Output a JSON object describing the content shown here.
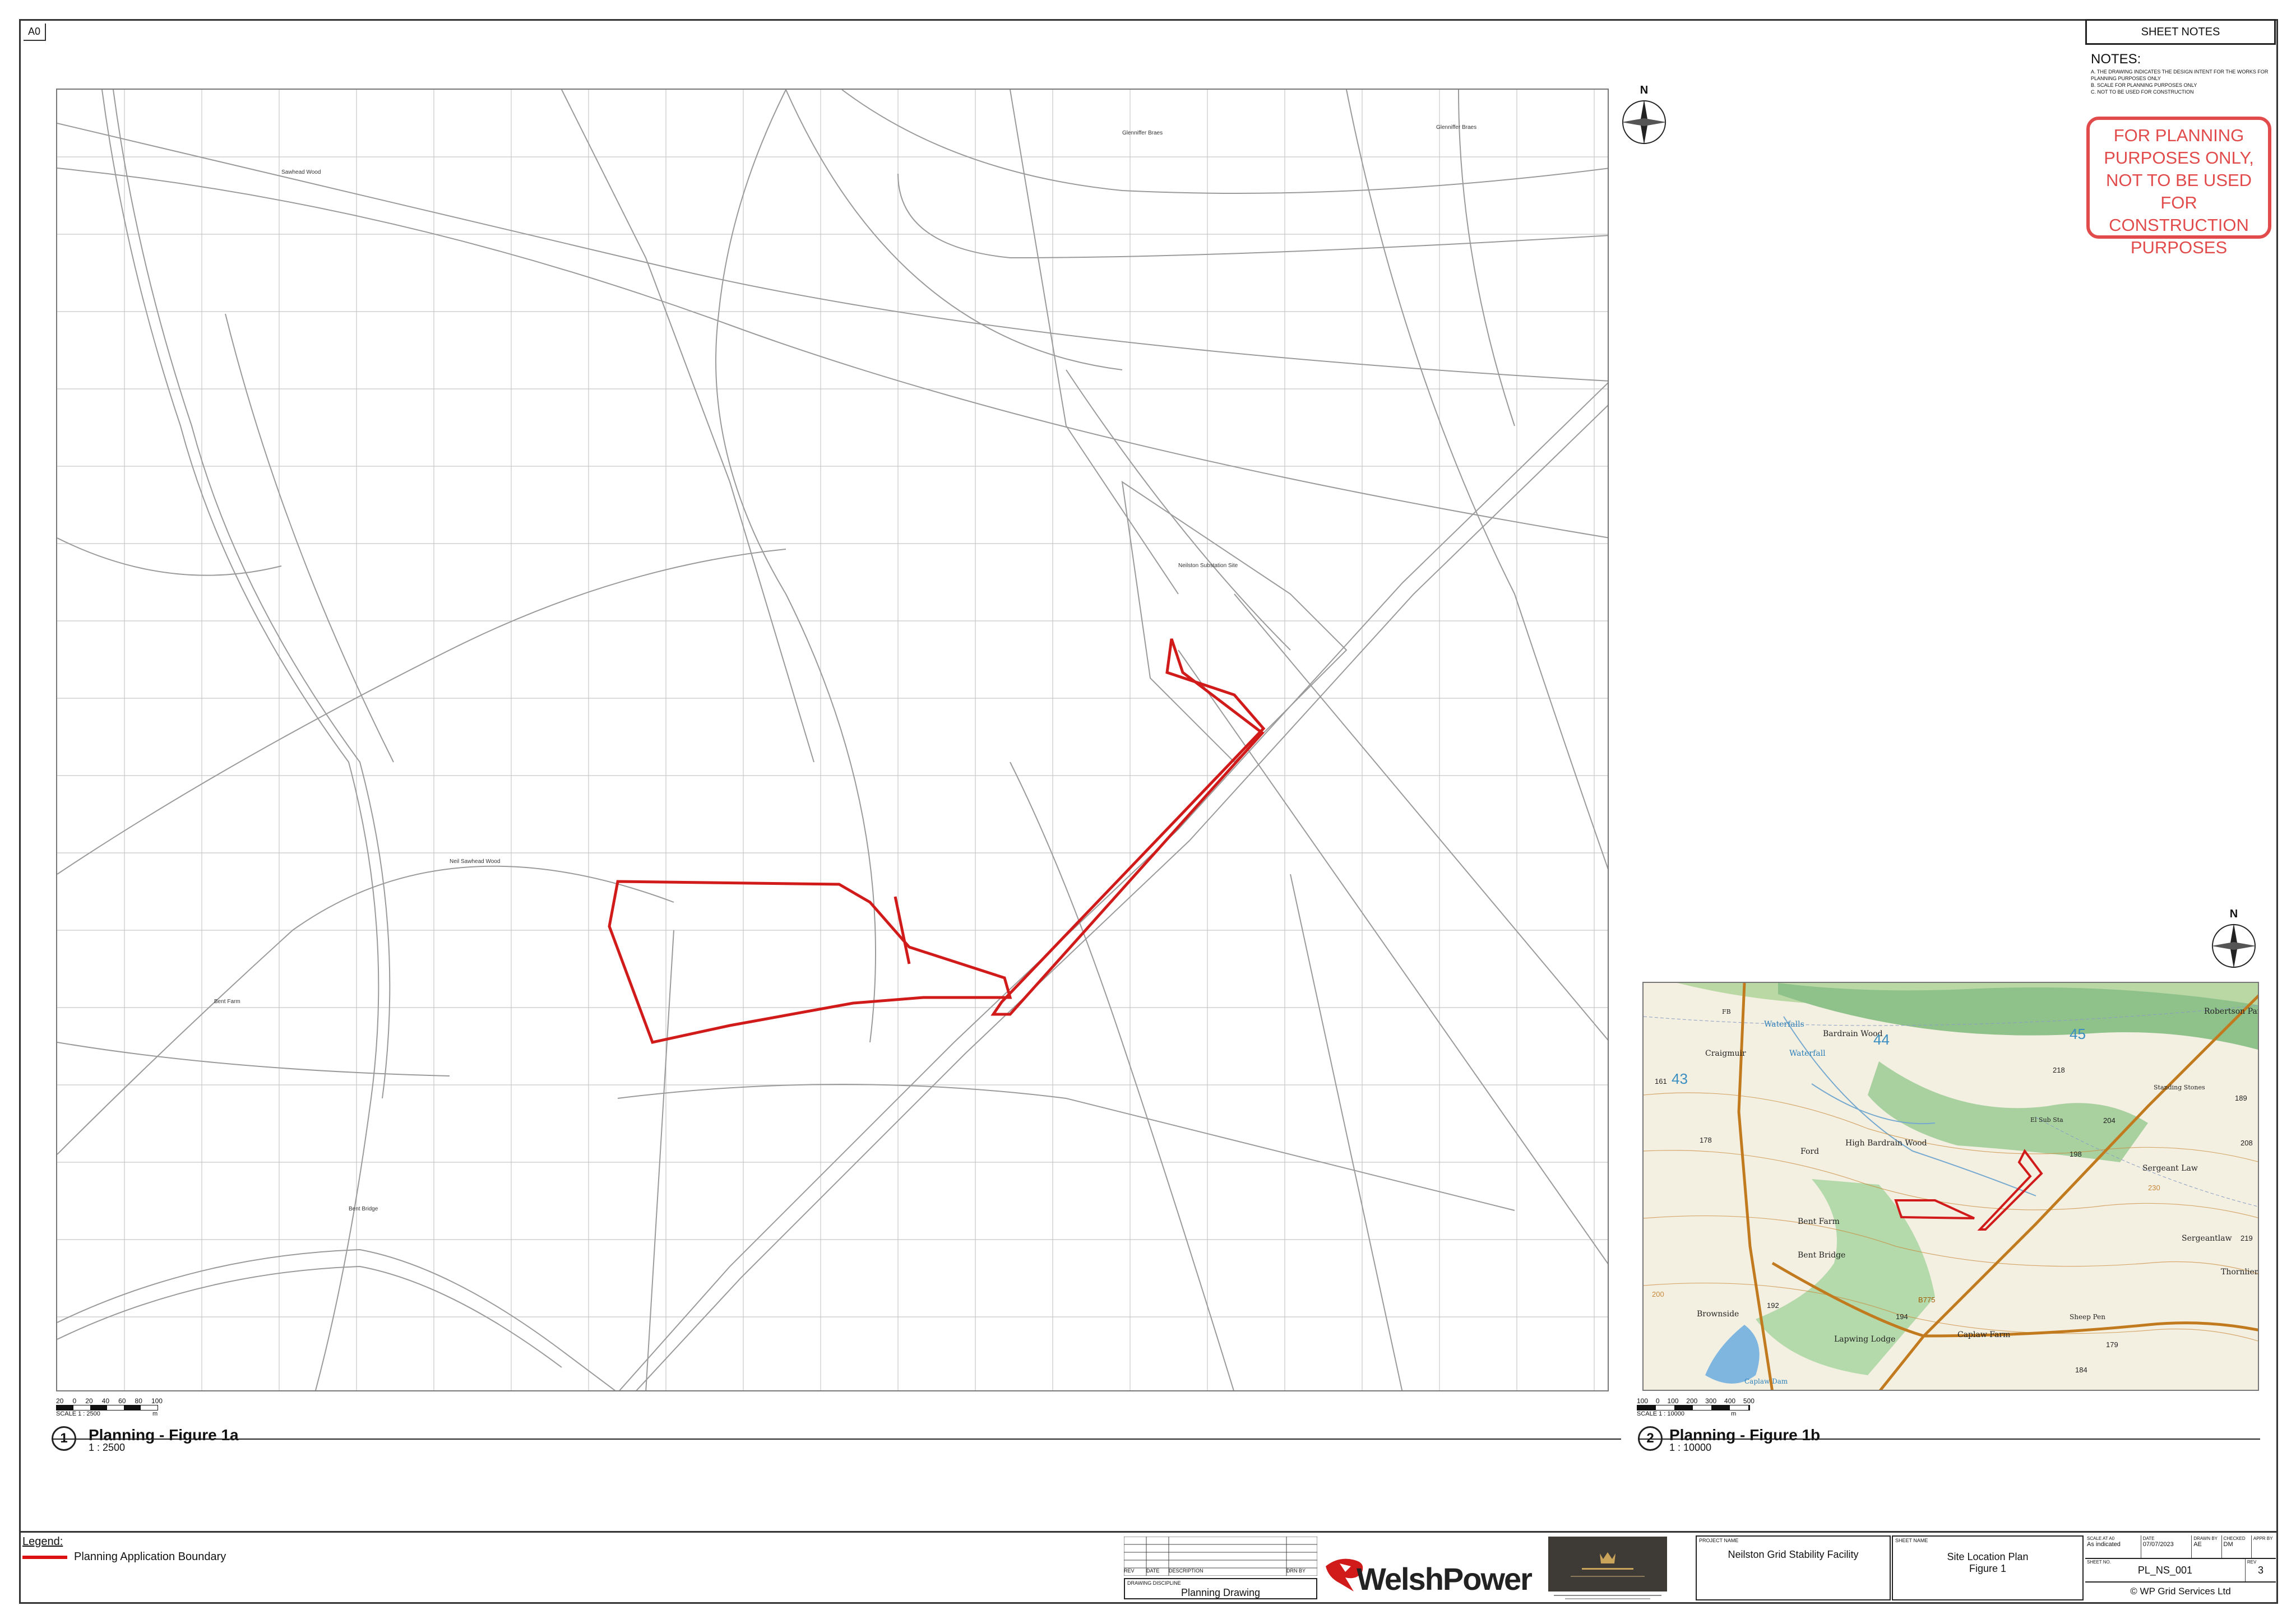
{
  "sheet": {
    "size": "A0",
    "sheet_notes_title": "SHEET NOTES",
    "notes_heading": "NOTES:",
    "notes": [
      "A.  THE DRAWING INDICATES THE DESIGN INTENT FOR THE WORKS FOR PLANNING PURPOSES ONLY",
      "B.  SCALE FOR PLANNING PURPOSES ONLY",
      "C.  NOT TO BE USED FOR CONSTRUCTION"
    ],
    "stamp_lines": [
      "FOR PLANNING",
      "PURPOSES ONLY,",
      "NOT TO BE USED FOR",
      "CONSTRUCTION",
      "PURPOSES"
    ]
  },
  "view_a": {
    "number": "1",
    "title": "Planning - Figure 1a",
    "scale": "1 : 2500",
    "scale_bar_labels": [
      "20",
      "0",
      "20",
      "40",
      "60",
      "80",
      "100"
    ],
    "scale_bar_caption": "SCALE 1 : 2500",
    "scale_bar_unit": "m",
    "north": "N"
  },
  "view_b": {
    "number": "2",
    "title": "Planning - Figure 1b",
    "scale": "1 : 10000",
    "scale_bar_labels": [
      "100",
      "0",
      "100",
      "200",
      "300",
      "400",
      "500"
    ],
    "scale_bar_caption": "SCALE 1 : 10000",
    "scale_bar_unit": "m",
    "north": "N",
    "place_labels": [
      "Bardrain Wood",
      "Robertson Park",
      "Waterfalls",
      "Waterfall",
      "Craigmuir",
      "El Sub Sta",
      "Standing Stones",
      "High Bardrain Wood",
      "Ford",
      "Sergeant Law",
      "Bent Farm",
      "Bent Bridge",
      "Sergeantlaw",
      "Thornliemu",
      "Brownside",
      "Lapwing Lodge",
      "Caplaw Farm",
      "Sheep Pen",
      "Caplaw Dam",
      "FB"
    ],
    "grid_labels": [
      "43",
      "44",
      "45"
    ],
    "spot_heights": [
      "161",
      "178",
      "218",
      "204",
      "189",
      "208",
      "198",
      "219",
      "192",
      "194",
      "179",
      "184",
      "230",
      "200"
    ],
    "road_label": "B775"
  },
  "legend": {
    "title": "Legend:",
    "items": [
      {
        "label": "Planning Application Boundary",
        "color": "#d11a1a"
      }
    ]
  },
  "revisions": {
    "headers": [
      "REV",
      "DATE",
      "DESCRIPTION",
      "DRN BY"
    ],
    "discipline_label": "DRAWING DISCIPLINE",
    "discipline": "Planning Drawing"
  },
  "client": {
    "name_part1": "Welsh",
    "name_part2": "Power"
  },
  "project": {
    "label": "PROJECT NAME",
    "name": "Neilston Grid Stability Facility"
  },
  "sheet_name": {
    "label": "SHEET NAME",
    "line1": "Site Location Plan",
    "line2": "Figure 1"
  },
  "drawing_info": {
    "scale_label": "SCALE AT A0",
    "scale": "As indicated",
    "date_label": "DATE",
    "date": "07/07/2023",
    "drawn_label": "DRAWN BY",
    "drawn": "AE",
    "checked_label": "CHECKED",
    "checked": "DM",
    "appr_label": "APPR BY",
    "sheet_no_label": "SHEET NO.",
    "sheet_no": "PL_NS_001",
    "rev_label": "REV",
    "rev": "3",
    "copyright": "© WP Grid Services Ltd"
  },
  "colors": {
    "boundary": "#d11a1a",
    "stamp": "#e24b4b",
    "linework": "#9a9a9a"
  },
  "map_a_labels": [
    "Glenniffer Braes",
    "Glenniffer Braes",
    "Sawhead Wood",
    "Neilston Substation Site",
    "Neil Sawhead Wood",
    "Bent Bridge",
    "Bent Farm"
  ]
}
